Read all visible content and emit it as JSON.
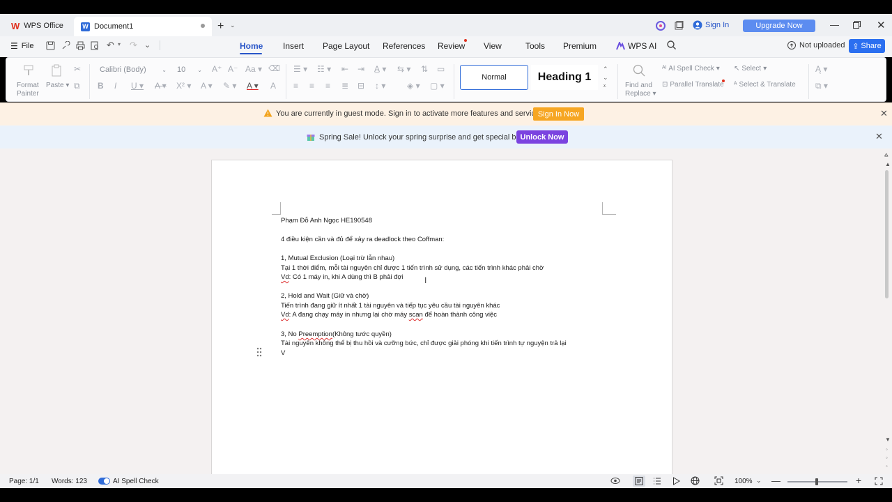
{
  "titlebar": {
    "app_tab": "WPS Office",
    "doc_tab": "Document1",
    "sign_in": "Sign In",
    "upgrade": "Upgrade Now"
  },
  "menubar": {
    "file": "File",
    "tabs": [
      "Home",
      "Insert",
      "Page Layout",
      "References",
      "Review",
      "View",
      "Tools",
      "Premium"
    ],
    "wps_ai": "WPS AI",
    "cloud_status": "Not uploaded",
    "share": "Share"
  },
  "ribbon": {
    "format_painter": [
      "Format",
      "Painter"
    ],
    "paste": "Paste",
    "font_name": "Calibri (Body)",
    "font_size": "10",
    "styles": {
      "normal": "Normal",
      "heading1": "Heading 1"
    },
    "find_replace": [
      "Find and",
      "Replace"
    ],
    "ai_spell_check": "AI Spell Check",
    "parallel_translate": "Parallel Translate",
    "select": "Select",
    "select_translate": "Select & Translate"
  },
  "guest_banner": {
    "text": "You are currently in guest mode. Sign in to activate more features and services.",
    "button": "Sign In Now"
  },
  "sale_banner": {
    "text": "Spring Sale! Unlock your spring surprise and get special bonus!",
    "button": "Unlock Now"
  },
  "document": {
    "lines": [
      "Phạm Đỗ Anh Ngọc HE190548",
      "4 điều kiện cần và đủ để xảy ra deadlock theo Coffman:",
      " 1, Mutual Exclusion (Loại trừ lẫn nhau)",
      "Tại 1 thời điểm, mỗi tài nguyên chỉ được 1 tiến trình sử dụng, các tiến trình khác phải chờ",
      "Có 1 máy in, khi A dùng thì B phải đợi",
      "2, Hold and Wait (Giữ và chờ)",
      "Tiến trình đang giữ ít nhất 1 tài nguyên và tiếp tục yêu cầu tài nguyên khác",
      "A đang chạy máy in nhưng lại chờ máy",
      "để hoàn thành công việc",
      "3, No",
      "(Không tước quyền)",
      "Tài nguyên không thể bị thu hồi và cưỡng bức, chỉ được giải phóng khi tiến trình tự nguyện trả lại",
      "V"
    ],
    "vd": "Vd",
    "scan": "scan",
    "preemption": "Preemption"
  },
  "statusbar": {
    "page": "Page: 1/1",
    "words": "Words: 123",
    "spell": "AI Spell Check",
    "zoom": "100%"
  }
}
